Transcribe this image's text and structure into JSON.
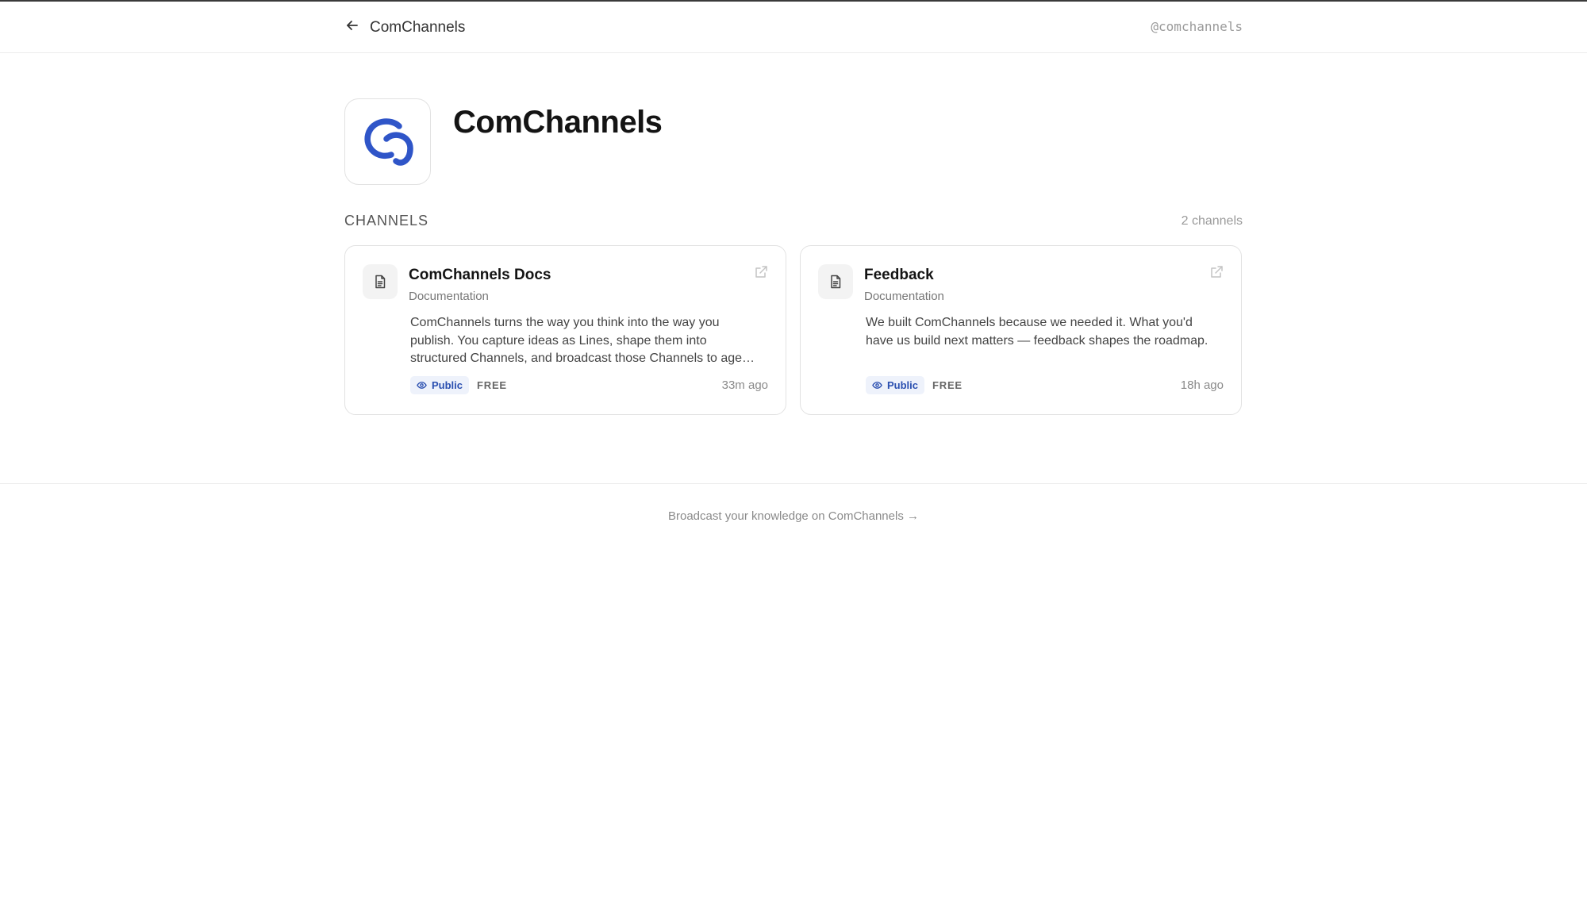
{
  "nav": {
    "back_label": "ComChannels",
    "handle": "@comchannels"
  },
  "profile": {
    "name": "ComChannels",
    "logo_color": "#2f55c8"
  },
  "channels_section": {
    "label": "CHANNELS",
    "count": "2 channels"
  },
  "channels": [
    {
      "title": "ComChannels Docs",
      "type": "Documentation",
      "description": "ComChannels turns the way you think into the way you publish. You capture ideas as Lines, shape them into structured Channels, and broadcast those Channels to agents and people alike.",
      "visibility": "Public",
      "price": "FREE",
      "updated": "33m ago"
    },
    {
      "title": "Feedback",
      "type": "Documentation",
      "description": "We built ComChannels because we needed it. What you'd have us build next matters — feedback shapes the roadmap.",
      "visibility": "Public",
      "price": "FREE",
      "updated": "18h ago"
    }
  ],
  "footer": {
    "cta": "Broadcast your knowledge on ComChannels →"
  },
  "icons": {
    "back": "arrow-left-icon",
    "channel": "document-icon",
    "external": "external-link-icon",
    "visibility": "eye-icon"
  }
}
